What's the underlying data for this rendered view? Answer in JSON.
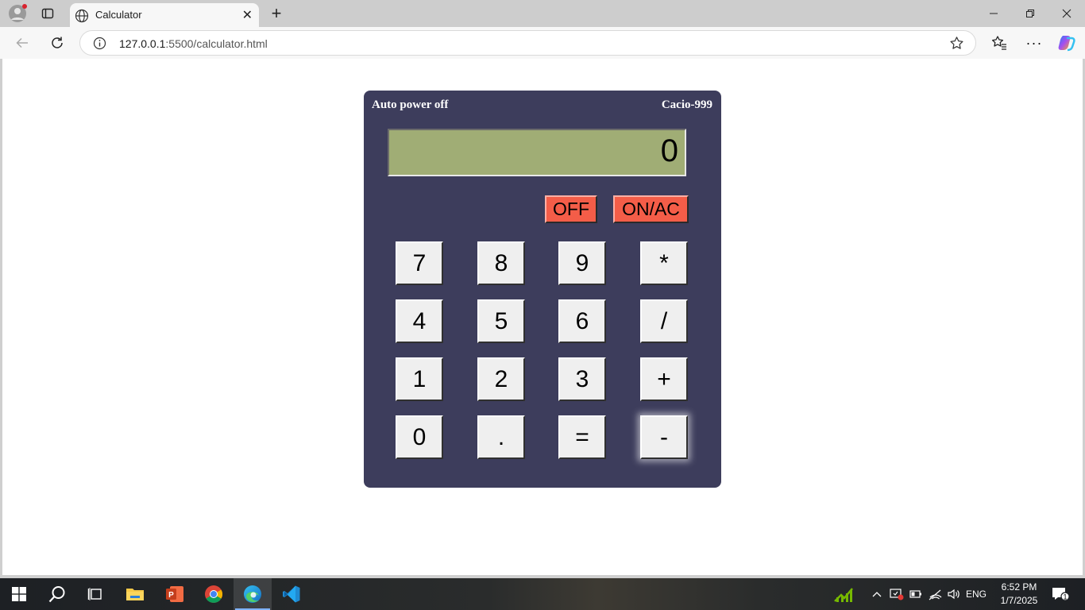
{
  "browser": {
    "tab_title": "Calculator",
    "url_host": "127.0.0.1",
    "url_rest": ":5500/calculator.html"
  },
  "calculator": {
    "auto_power_label": "Auto power off",
    "model_label": "Cacio-999",
    "display_value": "0",
    "off_label": "OFF",
    "on_label": "ON/AC",
    "keys": {
      "k7": "7",
      "k8": "8",
      "k9": "9",
      "mul": "*",
      "k4": "4",
      "k5": "5",
      "k6": "6",
      "div": "/",
      "k1": "1",
      "k2": "2",
      "k3": "3",
      "add": "+",
      "k0": "0",
      "dot": ".",
      "eq": "=",
      "sub": "-"
    },
    "colors": {
      "body": "#3d3d5c",
      "display": "#a0ad75",
      "power_button": "#f45d48",
      "key": "#efefef"
    }
  },
  "taskbar": {
    "apps": [
      "start-icon",
      "search-icon",
      "task-view-icon",
      "file-explorer-icon",
      "powerpoint-icon",
      "chrome-icon",
      "edge-icon",
      "vscode-icon"
    ],
    "language": "ENG",
    "time": "6:52 PM",
    "date": "1/7/2025",
    "notification_count": "1"
  }
}
